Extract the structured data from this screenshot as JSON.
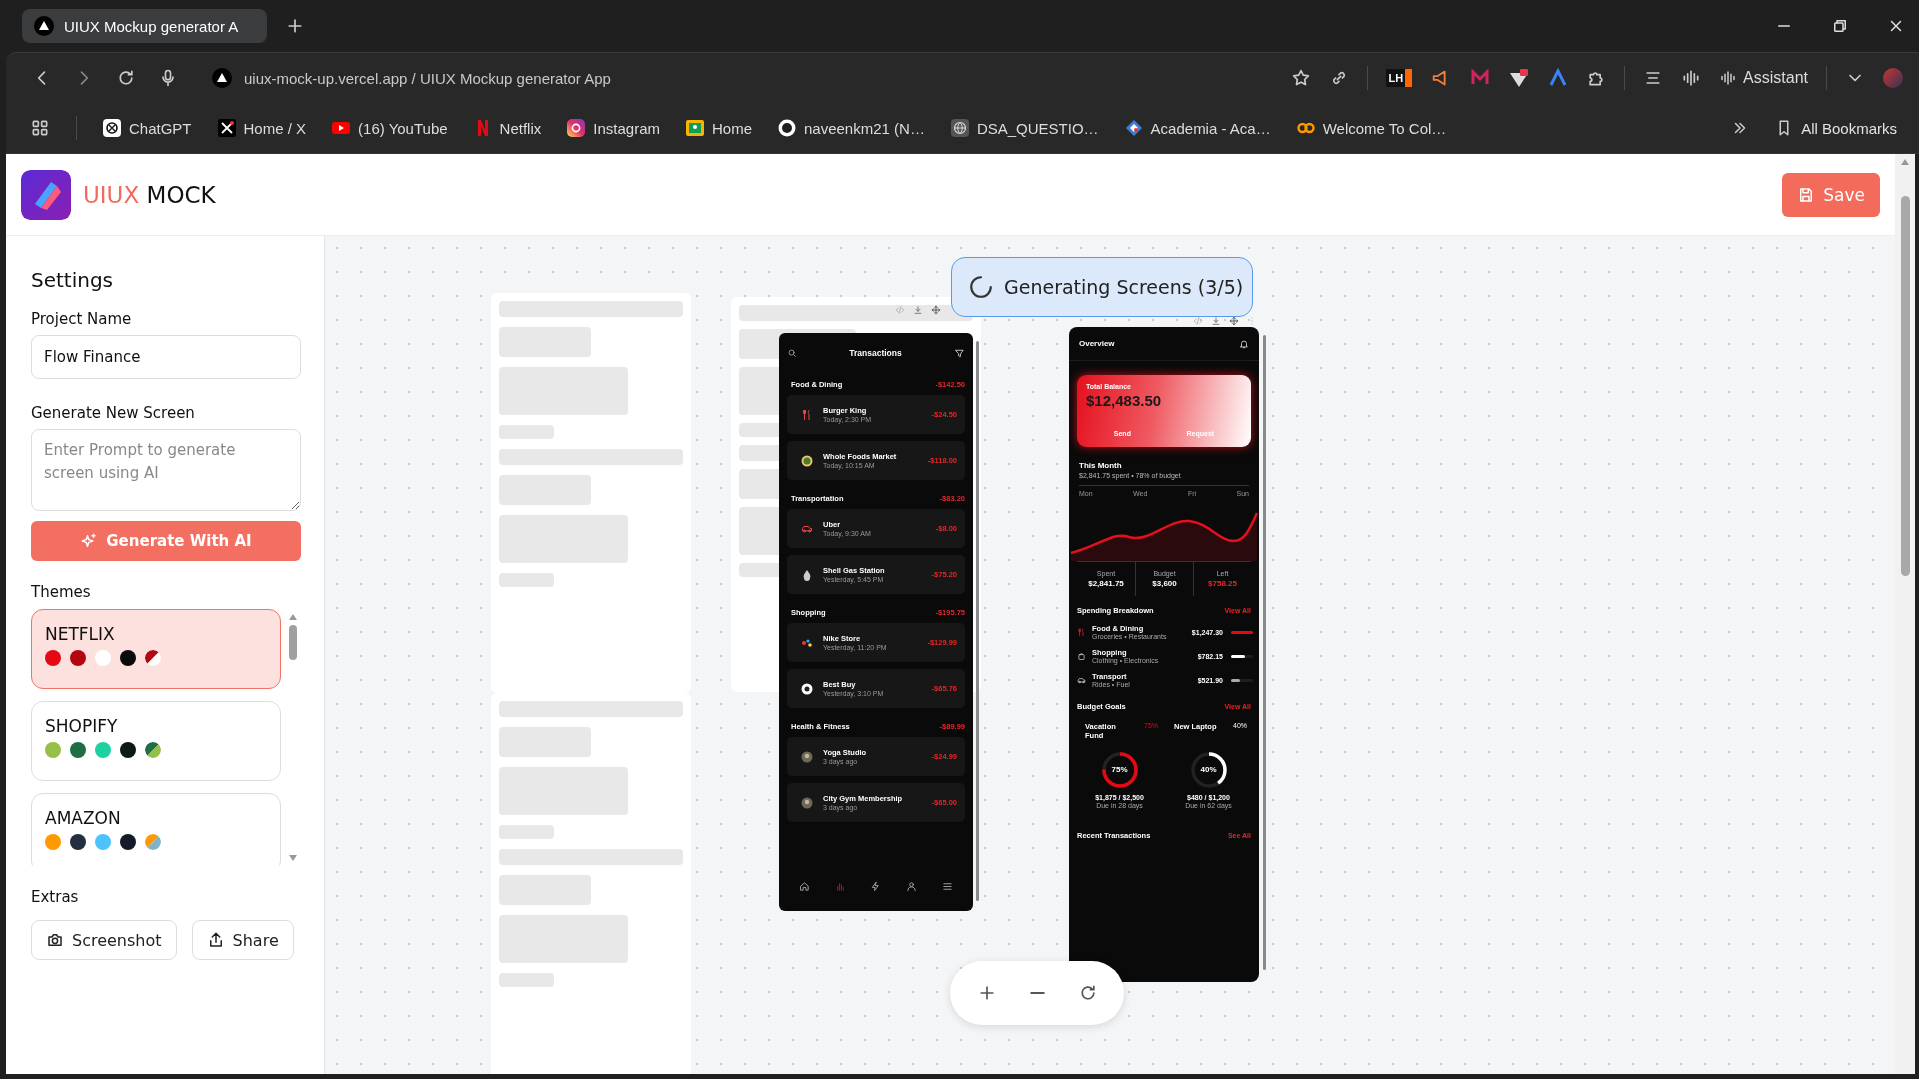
{
  "browser": {
    "tab": {
      "title": "UIUX Mockup generator A",
      "selected": true
    },
    "address": "uiux-mock-up.vercel.app / UIUX Mockup generator App",
    "extension_badge": "LH",
    "assistant": "Assistant",
    "bookmarks": [
      {
        "label": "ChatGPT",
        "kind": "knot"
      },
      {
        "label": "Home / X",
        "kind": "cross"
      },
      {
        "label": "(16) YouTube",
        "kind": "play"
      },
      {
        "label": "Netflix",
        "kind": "ribbon"
      },
      {
        "label": "Instagram",
        "kind": "camera"
      },
      {
        "label": "Home",
        "kind": "frame"
      },
      {
        "label": "naveenkm21 (N…",
        "kind": "cat"
      },
      {
        "label": "DSA_QUESTIO…",
        "kind": "globe"
      },
      {
        "label": "Academia - Aca…",
        "kind": "diamond"
      },
      {
        "label": "Welcome To Col…",
        "kind": "rings"
      }
    ],
    "all_bookmarks": "All Bookmarks"
  },
  "app": {
    "logo_first": "UIUX",
    "logo_second": "MOCK",
    "save": "Save"
  },
  "settings": {
    "title": "Settings",
    "project_label": "Project Name",
    "project_value": "Flow Finance",
    "generate_label": "Generate New Screen",
    "prompt_placeholder": "Enter Prompt to generate screen using AI",
    "generate_button": "Generate With AI",
    "themes_label": "Themes",
    "themes": [
      {
        "name": "NETFLIX",
        "selected": true,
        "dots": [
          {
            "color": "#e50914",
            "kind": "solid"
          },
          {
            "color": "#b20710",
            "kind": "solid"
          },
          {
            "color": "#ffffff",
            "kind": "solid"
          },
          {
            "color": "#0b0b0b",
            "kind": "solid"
          },
          {
            "color": "#b20710",
            "kind": "gradient"
          },
          {
            "color": "#ffffff",
            "kind": "gradient"
          }
        ]
      },
      {
        "name": "SHOPIFY",
        "selected": false,
        "dots": [
          {
            "color": "#95bf47",
            "kind": "solid"
          },
          {
            "color": "#1e6f43",
            "kind": "solid"
          },
          {
            "color": "#1dd1a1",
            "kind": "solid"
          },
          {
            "color": "#0b1a12",
            "kind": "solid"
          },
          {
            "color": "#1e6f43",
            "kind": "gradient"
          },
          {
            "color": "#95bf47",
            "kind": "gradient"
          }
        ]
      },
      {
        "name": "AMAZON",
        "selected": false,
        "dots": [
          {
            "color": "#ff9900",
            "kind": "solid"
          },
          {
            "color": "#232f3e",
            "kind": "solid"
          },
          {
            "color": "#4cc3ff",
            "kind": "solid"
          },
          {
            "color": "#131a2a",
            "kind": "solid"
          },
          {
            "color": "#ff9900",
            "kind": "gradient"
          },
          {
            "color": "#7fb3c8",
            "kind": "gradient"
          }
        ]
      }
    ],
    "extras_label": "Extras",
    "extras": [
      {
        "label": "Screenshot",
        "kind": "camera"
      },
      {
        "label": "Share",
        "kind": "share"
      }
    ]
  },
  "canvas": {
    "status": "Generating Screens (3/5)",
    "transactions": {
      "title": "Transactions",
      "groups": [
        {
          "name": "Food & Dining",
          "total": "-$142.50",
          "items": [
            {
              "name": "Burger King",
              "time": "Today, 2:30 PM",
              "amount": "-$24.50",
              "kind": "utensils"
            },
            {
              "name": "Whole Foods Market",
              "time": "Today, 10:15 AM",
              "amount": "-$118.00",
              "kind": "bowl"
            }
          ]
        },
        {
          "name": "Transportation",
          "total": "-$83.20",
          "items": [
            {
              "name": "Uber",
              "time": "Today, 9:30 AM",
              "amount": "-$8.00",
              "kind": "car"
            },
            {
              "name": "Shell Gas Station",
              "time": "Yesterday, 5:45 PM",
              "amount": "-$75.20",
              "kind": "drop"
            }
          ]
        },
        {
          "name": "Shopping",
          "total": "-$195.75",
          "items": [
            {
              "name": "Nike Store",
              "time": "Yesterday, 11:20 PM",
              "amount": "-$129.99",
              "kind": "logo"
            },
            {
              "name": "Best Buy",
              "time": "Yesterday, 3:10 PM",
              "amount": "-$65.76",
              "kind": "badge"
            }
          ]
        },
        {
          "name": "Health & Fitness",
          "total": "-$89.99",
          "items": [
            {
              "name": "Yoga Studio",
              "time": "3 days ago",
              "amount": "-$24.99",
              "kind": "photo"
            },
            {
              "name": "City Gym Membership",
              "time": "3 days ago",
              "amount": "-$65.00",
              "kind": "photo"
            }
          ]
        }
      ],
      "nav": [
        {
          "kind": "home",
          "selected": false
        },
        {
          "kind": "bars",
          "selected": true
        },
        {
          "kind": "bolt",
          "selected": false
        },
        {
          "kind": "user",
          "selected": false
        },
        {
          "kind": "menu",
          "selected": false
        }
      ]
    },
    "overview": {
      "title": "Overview",
      "balance": {
        "label": "Total Balance",
        "amount": "$12,483.50",
        "actions": [
          "Send",
          "Request"
        ]
      },
      "month": {
        "title": "This Month",
        "subtitle": "$2,841.75 spent • 78% of budget",
        "days": [
          "Mon",
          "Wed",
          "Fri",
          "Sun"
        ],
        "stats": [
          {
            "label": "Spent",
            "value": "$2,841.75",
            "alert": false
          },
          {
            "label": "Budget",
            "value": "$3,600",
            "alert": false
          },
          {
            "label": "Left",
            "value": "$758.25",
            "alert": true
          }
        ]
      },
      "breakdown": {
        "title": "Spending Breakdown",
        "link": "View All",
        "items": [
          {
            "name": "Food & Dining",
            "detail": "Groceries • Restaurants",
            "amount": "$1,247.30",
            "level": 1,
            "color": "#e50914",
            "kind": "utensils"
          },
          {
            "name": "Shopping",
            "detail": "Clothing • Electronics",
            "amount": "$782.15",
            "level": 0.62,
            "color": "#ffffff",
            "kind": "bag"
          },
          {
            "name": "Transport",
            "detail": "Rides • Fuel",
            "amount": "$521.90",
            "level": 0.42,
            "color": "#aaaaaa",
            "kind": "car"
          }
        ]
      },
      "goals": {
        "title": "Budget Goals",
        "link": "View All",
        "items": [
          {
            "name": "Vacation Fund",
            "badge": "75%",
            "percent": "75%",
            "level": 0.75,
            "color": "#e50914",
            "amount": "$1,875 / $2,500",
            "due": "Due in 28 days"
          },
          {
            "name": "New Laptop",
            "badge": "40%",
            "percent": "40%",
            "level": 0.4,
            "color": "#ffffff",
            "amount": "$480 / $1,200",
            "due": "Due in 62 days"
          }
        ]
      },
      "recent": {
        "title": "Recent Transactions",
        "link": "See All"
      }
    }
  }
}
